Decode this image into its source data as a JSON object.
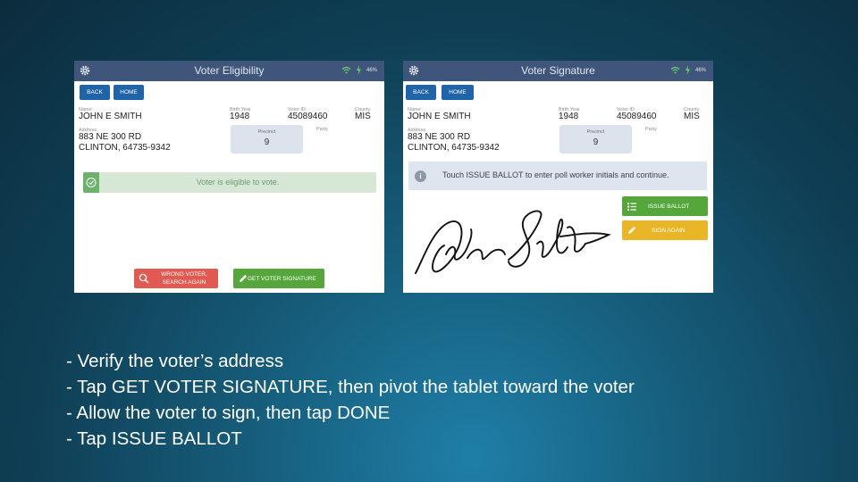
{
  "left_screen": {
    "title": "Voter Eligibility",
    "battery": "46%",
    "back_label": "BACK",
    "home_label": "HOME",
    "name_label": "Name",
    "name": "JOHN E SMITH",
    "birth_year_label": "Birth Year",
    "birth_year": "1948",
    "voter_id_label": "Voter ID",
    "voter_id": "45089460",
    "county_label": "County",
    "county": "MIS",
    "address_label": "Address",
    "address_line1": "883 NE 300 RD",
    "address_line2": "CLINTON, 64735-9342",
    "precinct_label": "Precinct",
    "precinct": "9",
    "party_label": "Party",
    "eligible_message": "Voter is eligible to vote.",
    "wrong_voter_line1": "WRONG VOTER,",
    "wrong_voter_line2": "SEARCH AGAIN",
    "get_signature_label": "GET VOTER SIGNATURE",
    "colors": {
      "topbar": "#3f5579",
      "button": "#1f64a8",
      "red": "#e05a52",
      "green": "#55a63b"
    }
  },
  "right_screen": {
    "title": "Voter Signature",
    "battery": "46%",
    "back_label": "BACK",
    "home_label": "HOME",
    "name_label": "Name",
    "name": "JOHN E SMITH",
    "birth_year_label": "Birth Year",
    "birth_year": "1948",
    "voter_id_label": "Voter ID",
    "voter_id": "45089460",
    "county_label": "County",
    "county": "MIS",
    "address_label": "Address",
    "address_line1": "883 NE 300 RD",
    "address_line2": "CLINTON, 64735-9342",
    "precinct_label": "Precinct",
    "precinct": "9",
    "party_label": "Party",
    "info_message": "Touch ISSUE BALLOT to enter poll worker initials and continue.",
    "issue_ballot_label": "ISSUE BALLOT",
    "sign_again_label": "SIGN AGAIN",
    "colors": {
      "green": "#55a63b",
      "yellow": "#e8b626"
    }
  },
  "caption": {
    "line1": "- Verify the voter’s address",
    "line2": "- Tap GET VOTER SIGNATURE, then pivot the tablet toward the voter",
    "line3": "- Allow the voter to sign, then tap DONE",
    "line4": "- Tap ISSUE BALLOT"
  }
}
